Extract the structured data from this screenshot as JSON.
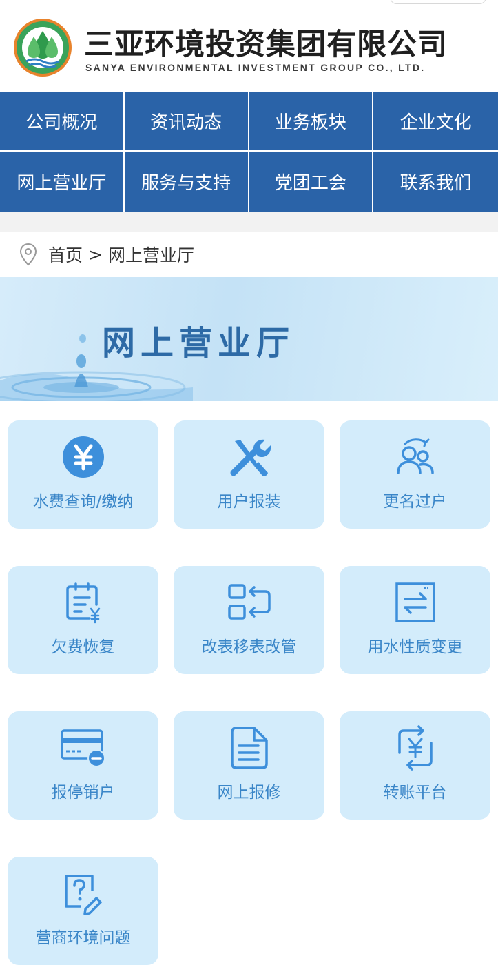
{
  "header": {
    "company_cn": "三亚环境投资集团有限公司",
    "company_en": "SANYA ENVIRONMENTAL INVESTMENT GROUP CO., LTD."
  },
  "nav": {
    "items": [
      "公司概况",
      "资讯动态",
      "业务板块",
      "企业文化",
      "网上营业厅",
      "服务与支持",
      "党团工会",
      "联系我们"
    ]
  },
  "breadcrumb": {
    "home": "首页",
    "separator": ">",
    "current": "网上营业厅"
  },
  "banner": {
    "title": "网上营业厅"
  },
  "services": [
    {
      "label": "水费查询/缴纳",
      "icon": "yen-coin-icon"
    },
    {
      "label": "用户报装",
      "icon": "tools-icon"
    },
    {
      "label": "更名过户",
      "icon": "users-transfer-icon"
    },
    {
      "label": "欠费恢复",
      "icon": "bill-yen-icon"
    },
    {
      "label": "改表移表改管",
      "icon": "swap-arrows-icon"
    },
    {
      "label": "用水性质变更",
      "icon": "exchange-box-icon"
    },
    {
      "label": "报停销户",
      "icon": "card-minus-icon"
    },
    {
      "label": "网上报修",
      "icon": "document-icon"
    },
    {
      "label": "转账平台",
      "icon": "yen-transfer-icon"
    },
    {
      "label": "营商环境问题",
      "icon": "question-edit-icon"
    }
  ],
  "colors": {
    "nav_bg": "#2a63a8",
    "card_bg": "#d3ecfb",
    "card_text": "#3a86c8",
    "icon": "#3d8fdb"
  }
}
